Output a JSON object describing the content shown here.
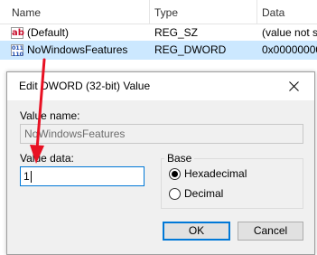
{
  "list": {
    "columns": [
      "Name",
      "Type",
      "Data"
    ],
    "rows": [
      {
        "name": "(Default)",
        "type": "REG_SZ",
        "data": "(value not s",
        "icon": "string-value-icon",
        "selected": false
      },
      {
        "name": "NoWindowsFeatures",
        "type": "REG_DWORD",
        "data": "0x00000000",
        "icon": "dword-value-icon",
        "selected": true
      }
    ],
    "icon_text": {
      "sz": "ab",
      "dword": "011\n110"
    }
  },
  "dialog": {
    "title": "Edit DWORD (32-bit) Value",
    "value_name_label": "Value name:",
    "value_name": "NoWindowsFeatures",
    "value_data_label": "Value data:",
    "value_data": "1",
    "base_label": "Base",
    "base_options": [
      "Hexadecimal",
      "Decimal"
    ],
    "base_selected": "Hexadecimal",
    "ok_label": "OK",
    "cancel_label": "Cancel"
  },
  "colors": {
    "selection": "#cce8ff",
    "dialog_bg": "#f0f0f0",
    "focus_border": "#0078d7",
    "annotation_arrow": "#e81123"
  }
}
